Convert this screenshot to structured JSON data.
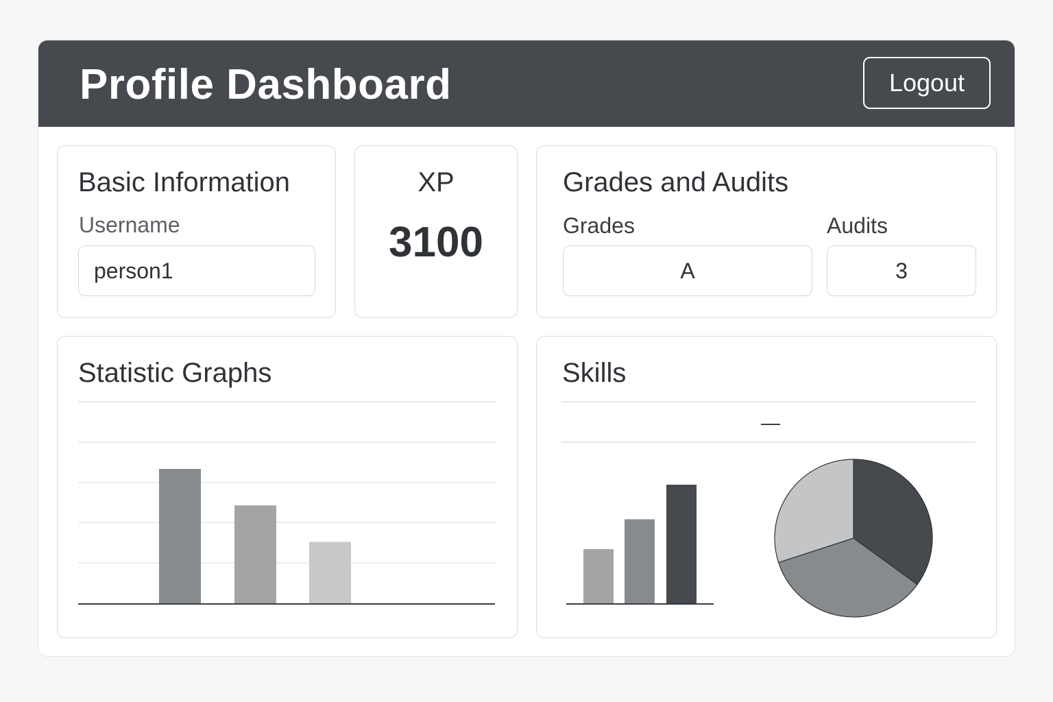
{
  "header": {
    "title": "Profile Dashboard",
    "logout_label": "Logout"
  },
  "basic_info": {
    "title": "Basic Information",
    "username_label": "Username",
    "username_value": "person1"
  },
  "xp": {
    "title": "XP",
    "value": "3100"
  },
  "grades_audits": {
    "title": "Grades and Audits",
    "grades_label": "Grades",
    "grades_value": "A",
    "audits_label": "Audits",
    "audits_value": "3"
  },
  "stats": {
    "title": "Statistic Graphs"
  },
  "skills": {
    "title": "Skills",
    "placeholder_mark": "—"
  },
  "colors": {
    "header_bg": "#46494e",
    "bar_dark": "#46494e",
    "bar_mid": "#888b8e",
    "bar_light": "#a3a4a6",
    "bar_lighter": "#c8c8c8"
  },
  "chart_data": [
    {
      "type": "bar",
      "categories": [
        "",
        "",
        ""
      ],
      "values": [
        100,
        73,
        46
      ],
      "colors": [
        "#888b8e",
        "#a3a4a6",
        "#c8c8c8"
      ],
      "grid": true,
      "ylim": [
        0,
        120
      ]
    },
    {
      "type": "bar",
      "categories": [
        "",
        "",
        ""
      ],
      "values": [
        46,
        71,
        100
      ],
      "colors": [
        "#a3a4a6",
        "#888b8e",
        "#46494e"
      ],
      "ylim": [
        0,
        100
      ]
    },
    {
      "type": "pie",
      "values": [
        35,
        35,
        30
      ],
      "colors": [
        "#46494e",
        "#888b8e",
        "#c4c5c7"
      ]
    }
  ]
}
